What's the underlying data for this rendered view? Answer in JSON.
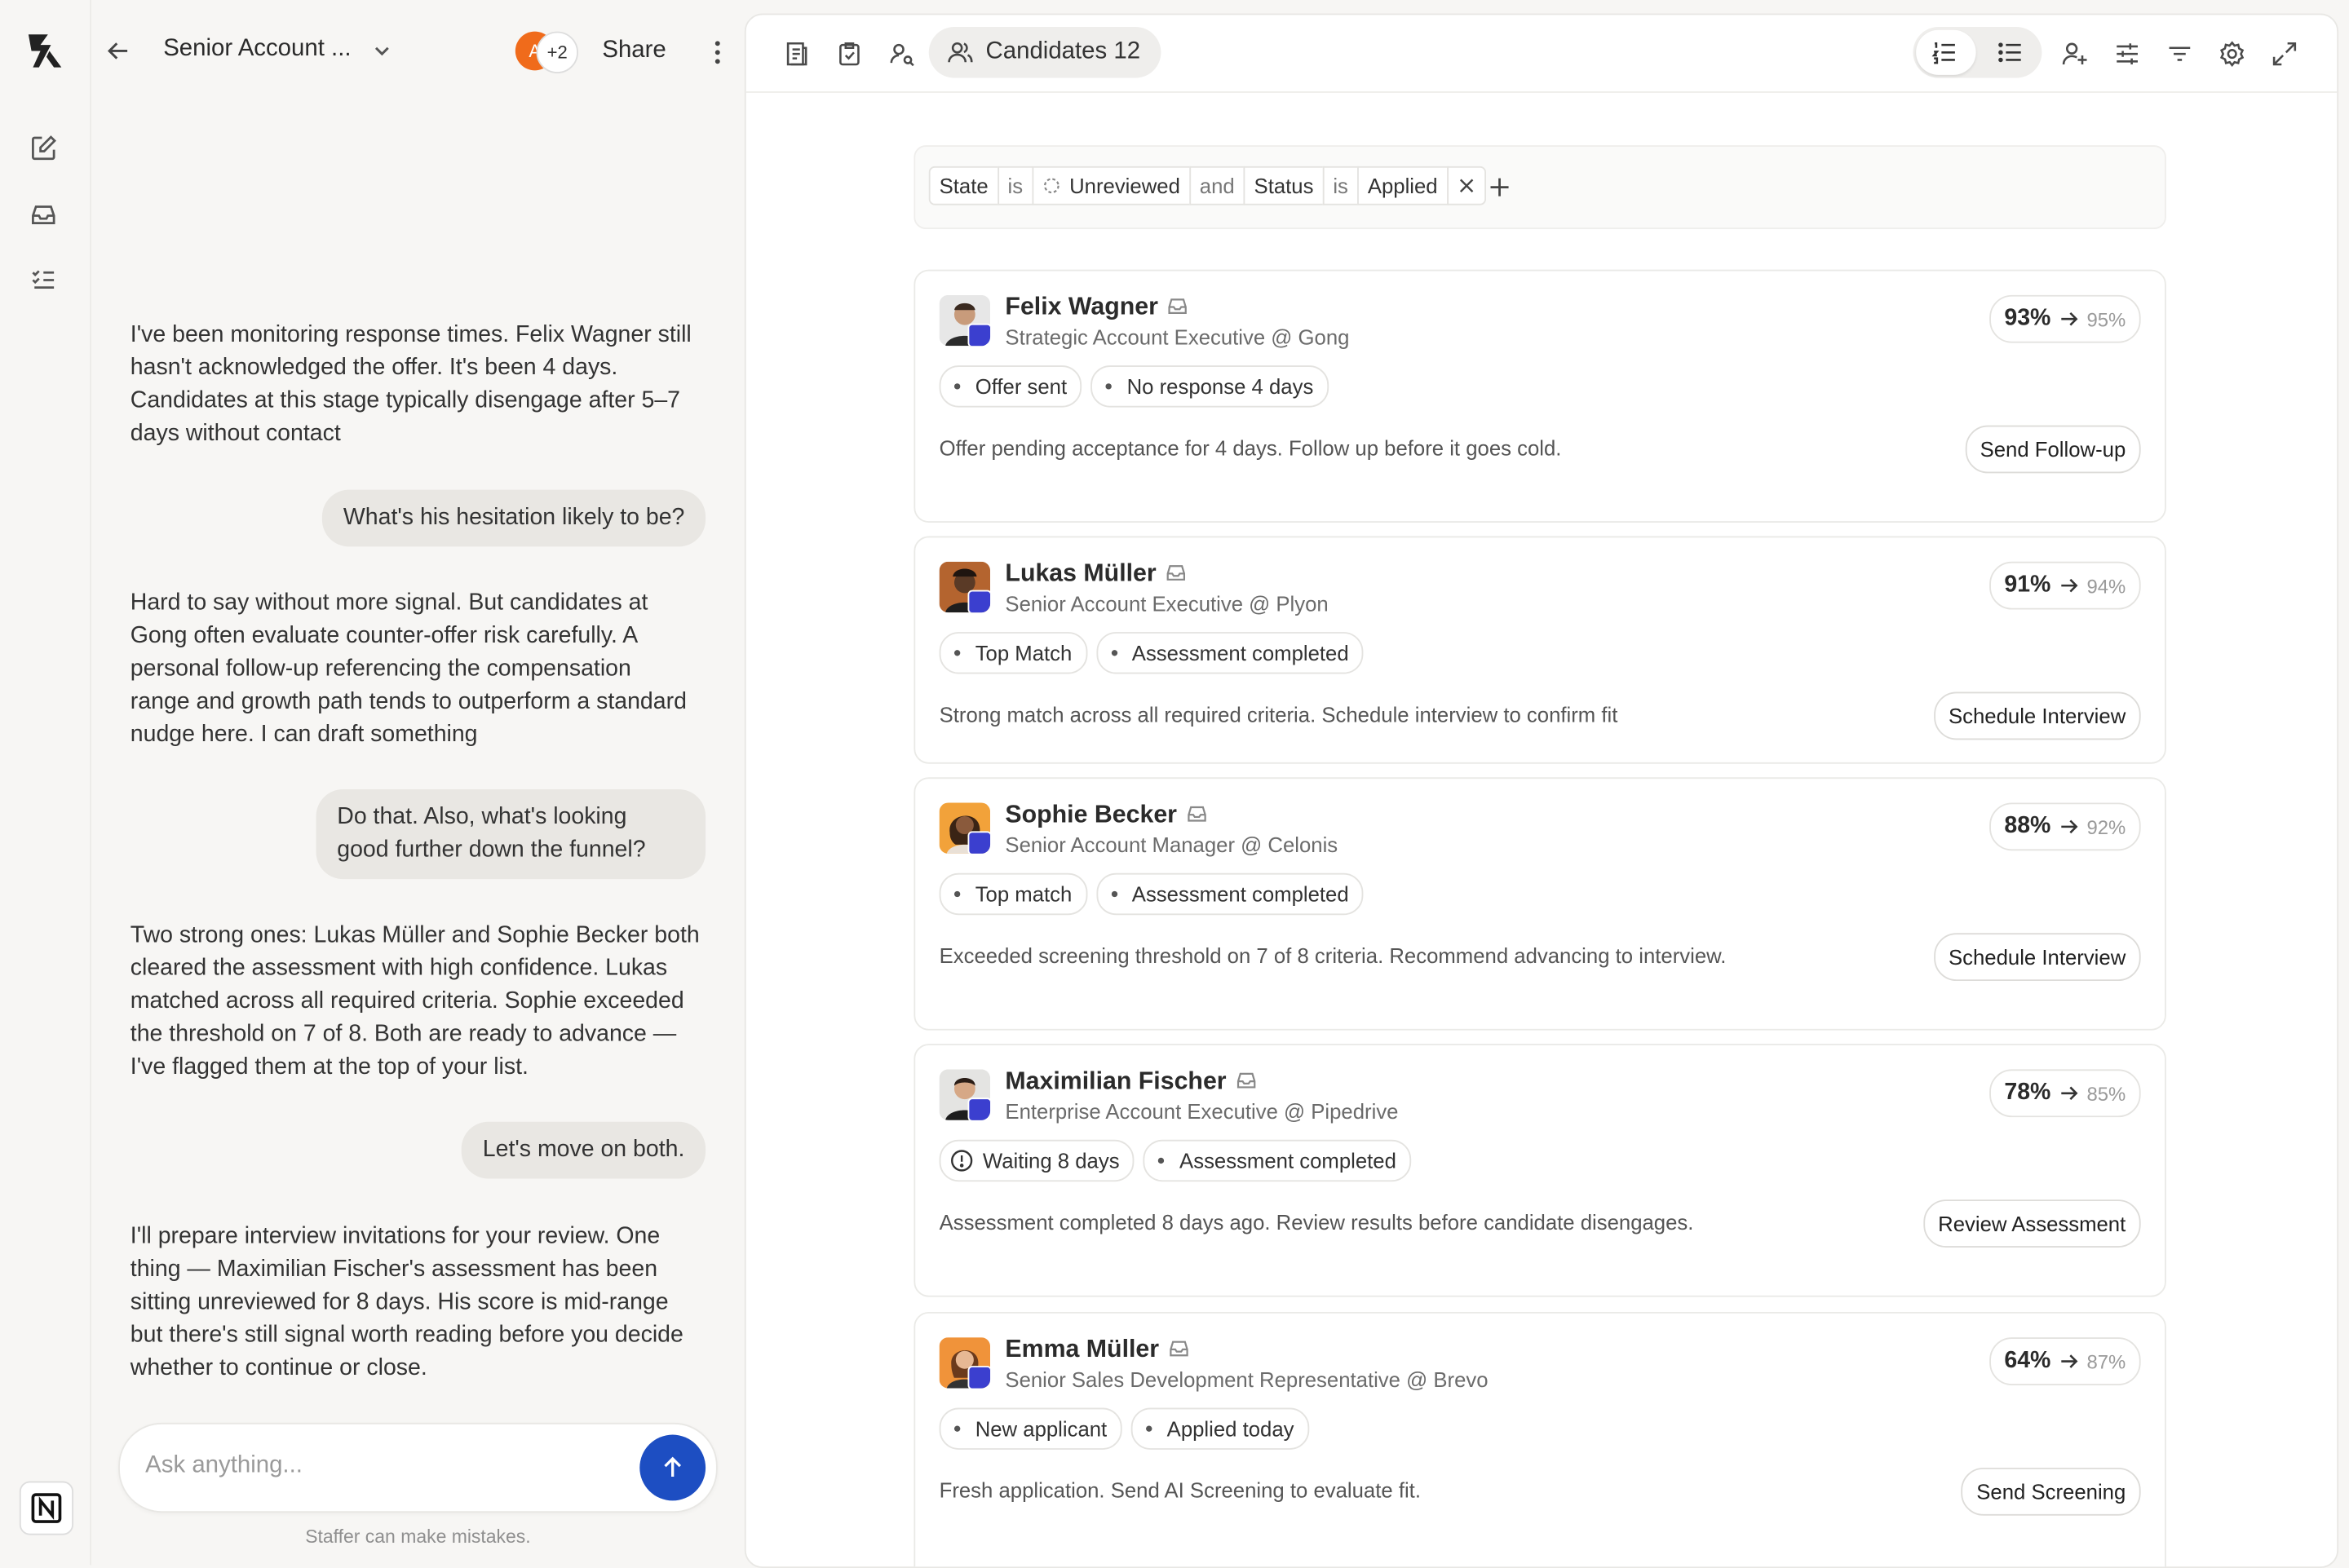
{
  "chat": {
    "title": "Senior Account ...",
    "avatar_initial": "A",
    "collab_count": "+2",
    "share_label": "Share",
    "messages": [
      {
        "role": "ai",
        "text": "I've been monitoring response times. Felix Wagner still hasn't acknowledged the offer. It's been 4 days. Candidates at this stage typically disengage after 5–7 days without contact"
      },
      {
        "role": "user",
        "text": "What's his hesitation likely to be?"
      },
      {
        "role": "ai",
        "text": "Hard to say without more signal. But candidates at Gong often evaluate counter-offer risk carefully. A personal follow-up referencing the compensation range and growth path tends to outperform a standard nudge here. I can draft something"
      },
      {
        "role": "user",
        "text": "Do that. Also, what's looking good further down the funnel?"
      },
      {
        "role": "ai",
        "text": "Two strong ones: Lukas Müller and Sophie Becker both cleared the assessment with high confidence. Lukas matched across all required criteria. Sophie exceeded the threshold on 7 of 8. Both are ready to advance — I've flagged them at the top of your list."
      },
      {
        "role": "user",
        "text": "Let's move on both."
      },
      {
        "role": "ai",
        "text": "I'll prepare interview invitations for your review. One thing — Maximilian Fischer's assessment has been sitting unreviewed for 8 days. His score is mid-range but there's still signal worth reading before you decide whether to continue or close."
      }
    ],
    "composer_placeholder": "Ask anything...",
    "disclaimer": "Staffer can make mistakes."
  },
  "toolbar": {
    "candidates_label": "Candidates 12"
  },
  "filters": {
    "f1_field": "State",
    "f1_op": "is",
    "f1_value": "Unreviewed",
    "joiner": "and",
    "f2_field": "Status",
    "f2_op": "is",
    "f2_value": "Applied"
  },
  "candidates": [
    {
      "name": "Felix Wagner",
      "role": "Strategic Account Executive @ Gong",
      "tags": [
        "Offer sent",
        "No response 4 days"
      ],
      "desc": "Offer pending acceptance for 4 days. Follow up before it goes cold.",
      "action": "Send Follow-up",
      "score": "93%",
      "predicted": "95%"
    },
    {
      "name": "Lukas Müller",
      "role": "Senior Account Executive @ Plyon",
      "tags": [
        "Top Match",
        "Assessment completed"
      ],
      "desc": "Strong match across all required criteria. Schedule interview to confirm fit",
      "action": "Schedule Interview",
      "score": "91%",
      "predicted": "94%"
    },
    {
      "name": "Sophie Becker",
      "role": "Senior Account Manager @ Celonis",
      "tags": [
        "Top match",
        "Assessment completed"
      ],
      "desc": "Exceeded screening threshold on 7 of 8 criteria. Recommend advancing to interview.",
      "action": "Schedule Interview",
      "score": "88%",
      "predicted": "92%"
    },
    {
      "name": "Maximilian Fischer",
      "role": "Enterprise Account Executive @ Pipedrive",
      "tags": [
        "Waiting 8 days",
        "Assessment completed"
      ],
      "desc": "Assessment completed 8 days ago. Review results before candidate disengages.",
      "action": "Review Assessment",
      "score": "78%",
      "predicted": "85%"
    },
    {
      "name": "Emma Müller",
      "role": "Senior Sales Development Representative @ Brevo",
      "tags": [
        "New applicant",
        "Applied today"
      ],
      "desc": "Fresh application. Send AI Screening to evaluate fit.",
      "action": "Send Screening",
      "score": "64%",
      "predicted": "87%"
    }
  ],
  "colors": {
    "accent": "#1d4ec2",
    "badge": "#3b3fcf",
    "avatar_orange": "#f06b1b"
  }
}
